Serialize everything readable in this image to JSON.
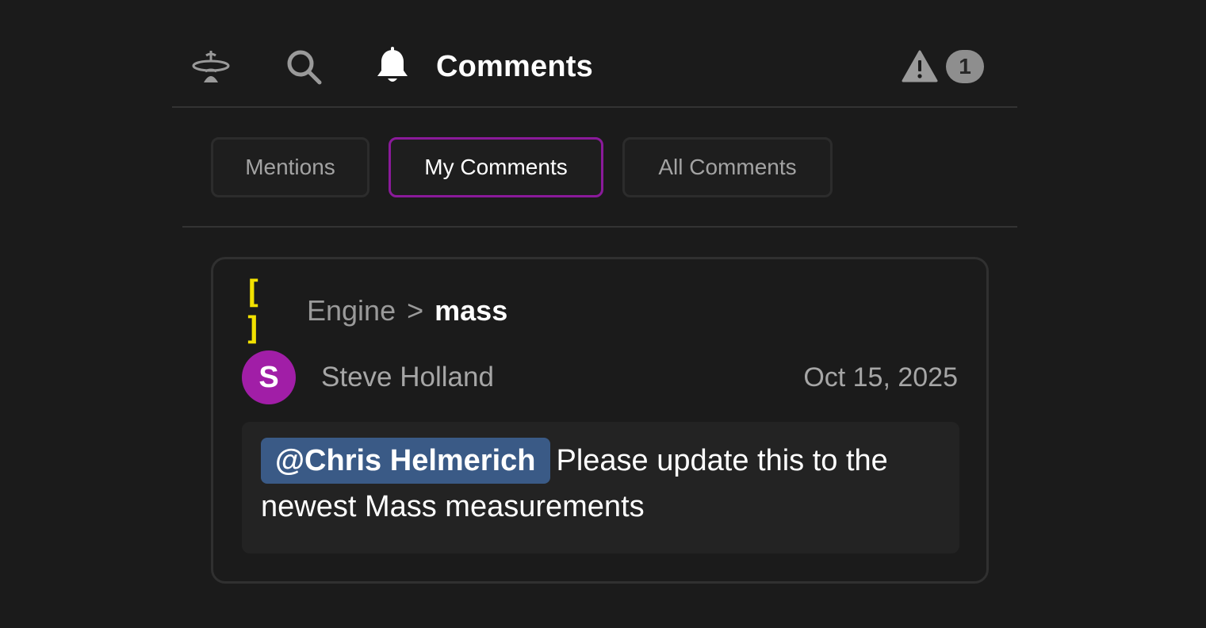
{
  "header": {
    "title": "Comments",
    "icons": [
      "logo-icon",
      "search-icon",
      "bell-icon",
      "alert-icon"
    ],
    "alert_count": "1"
  },
  "tabs": [
    {
      "label": "Mentions",
      "active": false
    },
    {
      "label": "My Comments",
      "active": true
    },
    {
      "label": "All Comments",
      "active": false
    }
  ],
  "comment": {
    "breadcrumb": {
      "icon": "[ ]",
      "parent": "Engine",
      "separator": ">",
      "current": "mass"
    },
    "author": {
      "initial": "S",
      "name": "Steve Holland"
    },
    "date": "Oct 15, 2025",
    "mention": "@Chris Helmerich",
    "text": "Please update this to the newest Mass measurements"
  },
  "colors": {
    "background": "#1b1b1b",
    "active_tab_border": "#8a1a9a",
    "avatar": "#a11ea7",
    "mention_bg": "#3a5a86",
    "breadcrumb_icon": "#f2e100"
  }
}
